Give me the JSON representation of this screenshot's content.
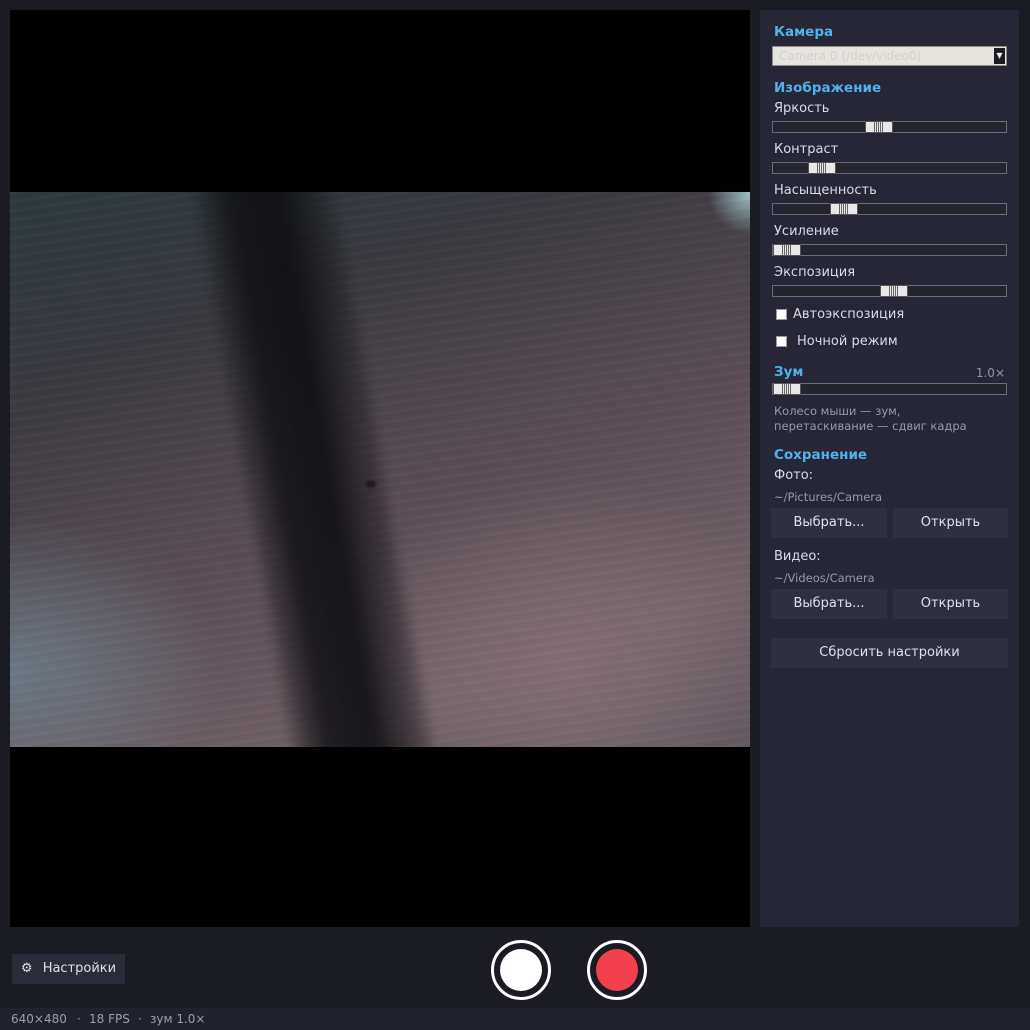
{
  "panel": {
    "camera": {
      "title": "Камера",
      "device_value": "Camera 0 (/dev/video0)"
    },
    "image": {
      "title": "Изображение",
      "sliders": [
        {
          "label": "Яркость",
          "value": 0.45
        },
        {
          "label": "Контраст",
          "value": 0.17
        },
        {
          "label": "Насыщенность",
          "value": 0.28
        },
        {
          "label": "Усиление",
          "value": 0.0
        },
        {
          "label": "Экспозиция",
          "value": 0.52
        }
      ],
      "auto_exposure_label": "Автоэкспозиция",
      "auto_exposure_checked": false,
      "night_mode_label": "Ночной режим",
      "night_mode_checked": false
    },
    "zoom": {
      "title": "Зум",
      "value_text": "1.0×",
      "slider_value": 0.0,
      "hint_line1": "Колесо мыши — зум,",
      "hint_line2": "перетаскивание — сдвиг кадра"
    },
    "save": {
      "title": "Сохранение",
      "photo_label": "Фото:",
      "photo_path": "~/Pictures/Camera",
      "video_label": "Видео:",
      "video_path": "~/Videos/Camera",
      "choose_label": "Выбрать...",
      "open_label": "Открыть",
      "reset_label": "Сбросить настройки"
    }
  },
  "bottom": {
    "settings_icon": "gear-icon",
    "settings_icon_glyph": "⚙",
    "settings_label": "Настройки",
    "photo_button_color": "#ffffff",
    "record_button_color": "#f2404f"
  },
  "status": {
    "resolution": "640×480",
    "sep": "·",
    "fps": "18 FPS",
    "zoom": "зум 1.0×"
  }
}
